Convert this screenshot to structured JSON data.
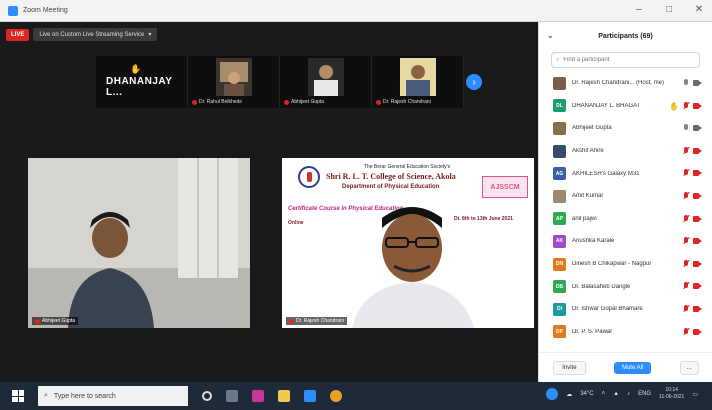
{
  "window": {
    "title": "Zoom Meeting"
  },
  "meeting": {
    "live_label": "LIVE",
    "stream_label": "Live on Custom Live Streaming Service",
    "gallery": [
      {
        "kind": "name",
        "name": "DHANANJAY L..."
      },
      {
        "kind": "video",
        "name": "Dr. Rahul Belkhede"
      },
      {
        "kind": "video",
        "name": "Abhijeet Gupta"
      },
      {
        "kind": "video",
        "name": "Dr. Rajesh Chandrani"
      }
    ],
    "main_tiles": [
      {
        "name": "Abhijeet Gupta"
      },
      {
        "name": "Dr. Rajesh Chandrani"
      }
    ],
    "poster": {
      "society": "The Berar General Education Society's",
      "college": "Shri R. L. T. College of Science, Akola",
      "department": "Department of Physical Education",
      "certificate": "Certificate Course in Physical Education",
      "dates": "Dt. 8th to 13th June 2021",
      "mode": "Online",
      "badge": "AJSSCM"
    }
  },
  "participants": {
    "title": "Participants (69)",
    "search_placeholder": "Find a participant",
    "list": [
      {
        "name": "Dr. Rajesh Chandrani... (Host, me)",
        "avatar_color": "#7a5f4e",
        "initials": "",
        "hand": false,
        "mic": "on",
        "cam": "on"
      },
      {
        "name": "DHANANJAY L. BHAGAT",
        "avatar_color": "#1a9c6b",
        "initials": "DL",
        "hand": true,
        "mic": "off",
        "cam": "off"
      },
      {
        "name": "Abhijeet Gupta",
        "avatar_color": "#8a6d4a",
        "initials": "",
        "hand": false,
        "mic": "on",
        "cam": "on"
      },
      {
        "name": "Akshit Ahire",
        "avatar_color": "#3a4a6a",
        "initials": "",
        "hand": false,
        "mic": "off",
        "cam": "off"
      },
      {
        "name": "AKHILESH's Galaxy M31",
        "avatar_color": "#3a5fa8",
        "initials": "AG",
        "hand": false,
        "mic": "off",
        "cam": "off"
      },
      {
        "name": "Amit Kumar",
        "avatar_color": "#9c8a70",
        "initials": "",
        "hand": false,
        "mic": "off",
        "cam": "off"
      },
      {
        "name": "anil pajwi",
        "avatar_color": "#2fa84f",
        "initials": "AP",
        "hand": false,
        "mic": "off",
        "cam": "off"
      },
      {
        "name": "Anushka Karale",
        "avatar_color": "#a04ac8",
        "initials": "AK",
        "hand": false,
        "mic": "off",
        "cam": "off"
      },
      {
        "name": "Dinesh B Chikapwar - Nagpur",
        "avatar_color": "#e07a1a",
        "initials": "DN",
        "hand": false,
        "mic": "off",
        "cam": "off"
      },
      {
        "name": "Dr. Balasaheb Dangle",
        "avatar_color": "#2fa84f",
        "initials": "DB",
        "hand": false,
        "mic": "off",
        "cam": "off"
      },
      {
        "name": "Dr. Ishwar Gopal Bhamare",
        "avatar_color": "#1a9c9c",
        "initials": "DI",
        "hand": false,
        "mic": "off",
        "cam": "off"
      },
      {
        "name": "Dr. P. S. Pawar",
        "avatar_color": "#e07a1a",
        "initials": "DP",
        "hand": false,
        "mic": "off",
        "cam": "off"
      }
    ],
    "footer": {
      "invite": "Invite",
      "mute_all": "Mute All",
      "more": "..."
    }
  },
  "taskbar": {
    "search_placeholder": "Type here to search",
    "weather": "34°C",
    "time": "10:14",
    "date": "11-06-2021",
    "lang": "ENG"
  }
}
